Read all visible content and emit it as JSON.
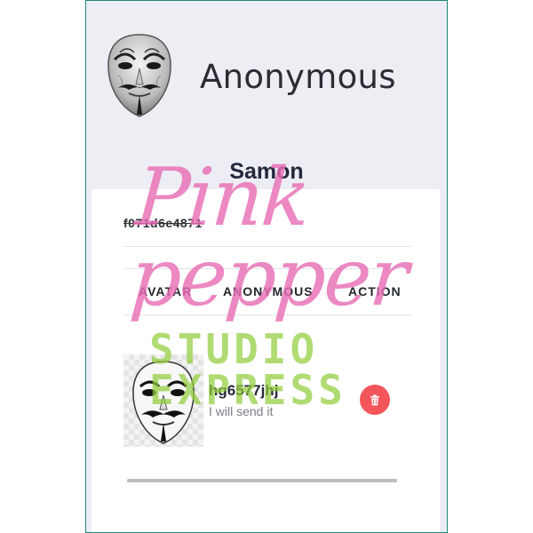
{
  "profile": {
    "name": "Anonymous",
    "username": "Samon",
    "token": "f071d6e4871"
  },
  "table": {
    "headers": [
      "AVATAR",
      "ANONYMOUS",
      "ACTION"
    ],
    "rows": [
      {
        "title": "hg6577jhj",
        "message": "I will send it"
      }
    ]
  },
  "icons": {
    "profile_avatar": "guy-fawkes-mask-icon",
    "row_avatar": "guy-fawkes-mask-icon",
    "delete": "trash-icon"
  },
  "watermark": {
    "line1": "Pink pepper",
    "line2": "STUDIO EXPRESS"
  },
  "colors": {
    "frame_border": "#1e8a7a",
    "page_bg": "#eceef4",
    "delete_button": "#f2555a",
    "watermark_pink": "#e86eb4",
    "watermark_green": "#91cd3c"
  }
}
